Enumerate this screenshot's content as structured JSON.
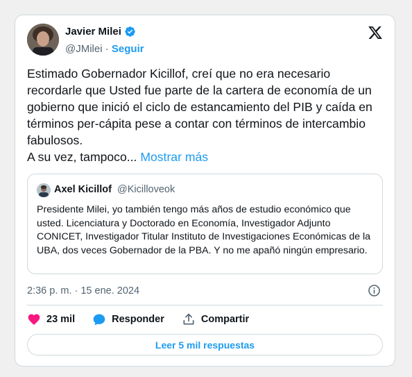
{
  "author": {
    "name": "Javier Milei",
    "handle": "@JMilei",
    "separator": "·",
    "follow_label": "Seguir"
  },
  "tweet": {
    "text": "Estimado Gobernador Kicillof, creí que no era necesario recordarle que Usted fue parte de la cartera de economía de un gobierno que inició el ciclo de estancamiento del PIB y caída en términos per-cápita pese a contar con términos de intercambio fabulosos.",
    "text_line2": "A su vez, tampoco...",
    "show_more_label": "Mostrar más"
  },
  "quote": {
    "name": "Axel Kicillof",
    "handle": "@Kicilloveok",
    "text": "Presidente Milei, yo también tengo más años de estudio económico que usted. Licenciatura y Doctorado en Economía, Investigador Adjunto CONICET, Investigador Titular Instituto de Investigaciones Económicas de la UBA, dos veces Gobernador de la PBA. Y no me apañó ningún empresario."
  },
  "timestamp": "2:36 p. m. · 15 ene. 2024",
  "actions": {
    "likes": "23 mil",
    "reply_label": "Responder",
    "share_label": "Compartir"
  },
  "read_replies_label": "Leer 5 mil respuestas",
  "colors": {
    "accent": "#1d9bf0",
    "like": "#f91880",
    "text": "#0f1419",
    "muted": "#536471",
    "border": "#cfd9de"
  },
  "icons": [
    "verified-badge-icon",
    "x-logo-icon",
    "info-icon",
    "heart-icon",
    "reply-bubble-icon",
    "share-icon"
  ]
}
